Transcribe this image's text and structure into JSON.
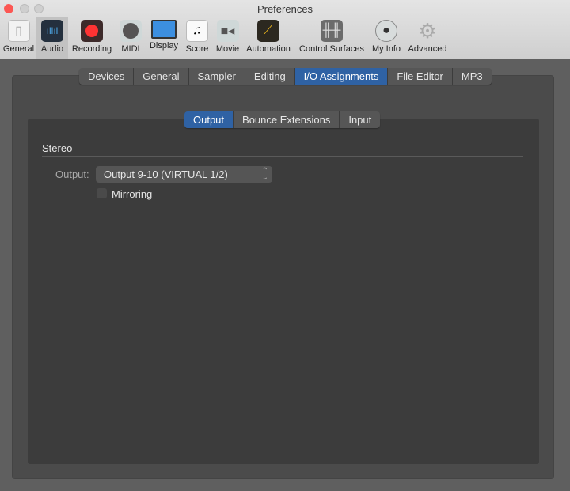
{
  "window": {
    "title": "Preferences"
  },
  "toolbar": [
    {
      "label": "General",
      "icon": "switch-icon"
    },
    {
      "label": "Audio",
      "icon": "waveform-icon",
      "selected": true
    },
    {
      "label": "Recording",
      "icon": "record-icon"
    },
    {
      "label": "MIDI",
      "icon": "midi-connector-icon"
    },
    {
      "label": "Display",
      "icon": "monitor-icon"
    },
    {
      "label": "Score",
      "icon": "music-note-icon"
    },
    {
      "label": "Movie",
      "icon": "video-camera-icon"
    },
    {
      "label": "Automation",
      "icon": "automation-icon"
    },
    {
      "label": "Control Surfaces",
      "icon": "faders-icon"
    },
    {
      "label": "My Info",
      "icon": "user-icon"
    },
    {
      "label": "Advanced",
      "icon": "gear-icon"
    }
  ],
  "tabs": [
    "Devices",
    "General",
    "Sampler",
    "Editing",
    "I/O Assignments",
    "File Editor",
    "MP3"
  ],
  "active_tab": "I/O Assignments",
  "subtabs": [
    "Output",
    "Bounce Extensions",
    "Input"
  ],
  "active_subtab": "Output",
  "section": {
    "title": "Stereo",
    "output_label": "Output:",
    "output_value": "Output 9-10 (VIRTUAL 1/2)",
    "mirroring_label": "Mirroring",
    "mirroring_checked": false
  },
  "colors": {
    "accent": "#2f62a4",
    "close": "#fc5753"
  }
}
